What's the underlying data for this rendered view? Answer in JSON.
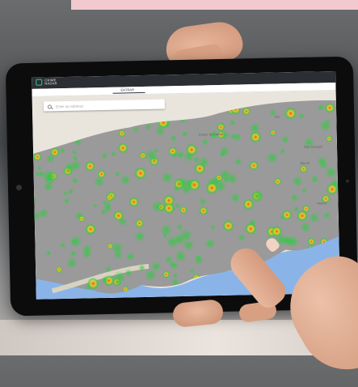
{
  "app": {
    "logo_text": "CRIME RADAR"
  },
  "tabs": {
    "active_label": "ENTRAR",
    "right_label": ""
  },
  "search": {
    "placeholder": "Enter an address"
  },
  "map": {
    "town_labels": [
      "Rio",
      "Duque de Caxias",
      "Niterói",
      "São Gonçalo",
      "Maricá"
    ],
    "heatmap_colors": [
      "#2ecc40",
      "#ffdc00",
      "#ff4136"
    ],
    "land_color": "#9a9a9a",
    "water_color": "#8ab4e8"
  }
}
